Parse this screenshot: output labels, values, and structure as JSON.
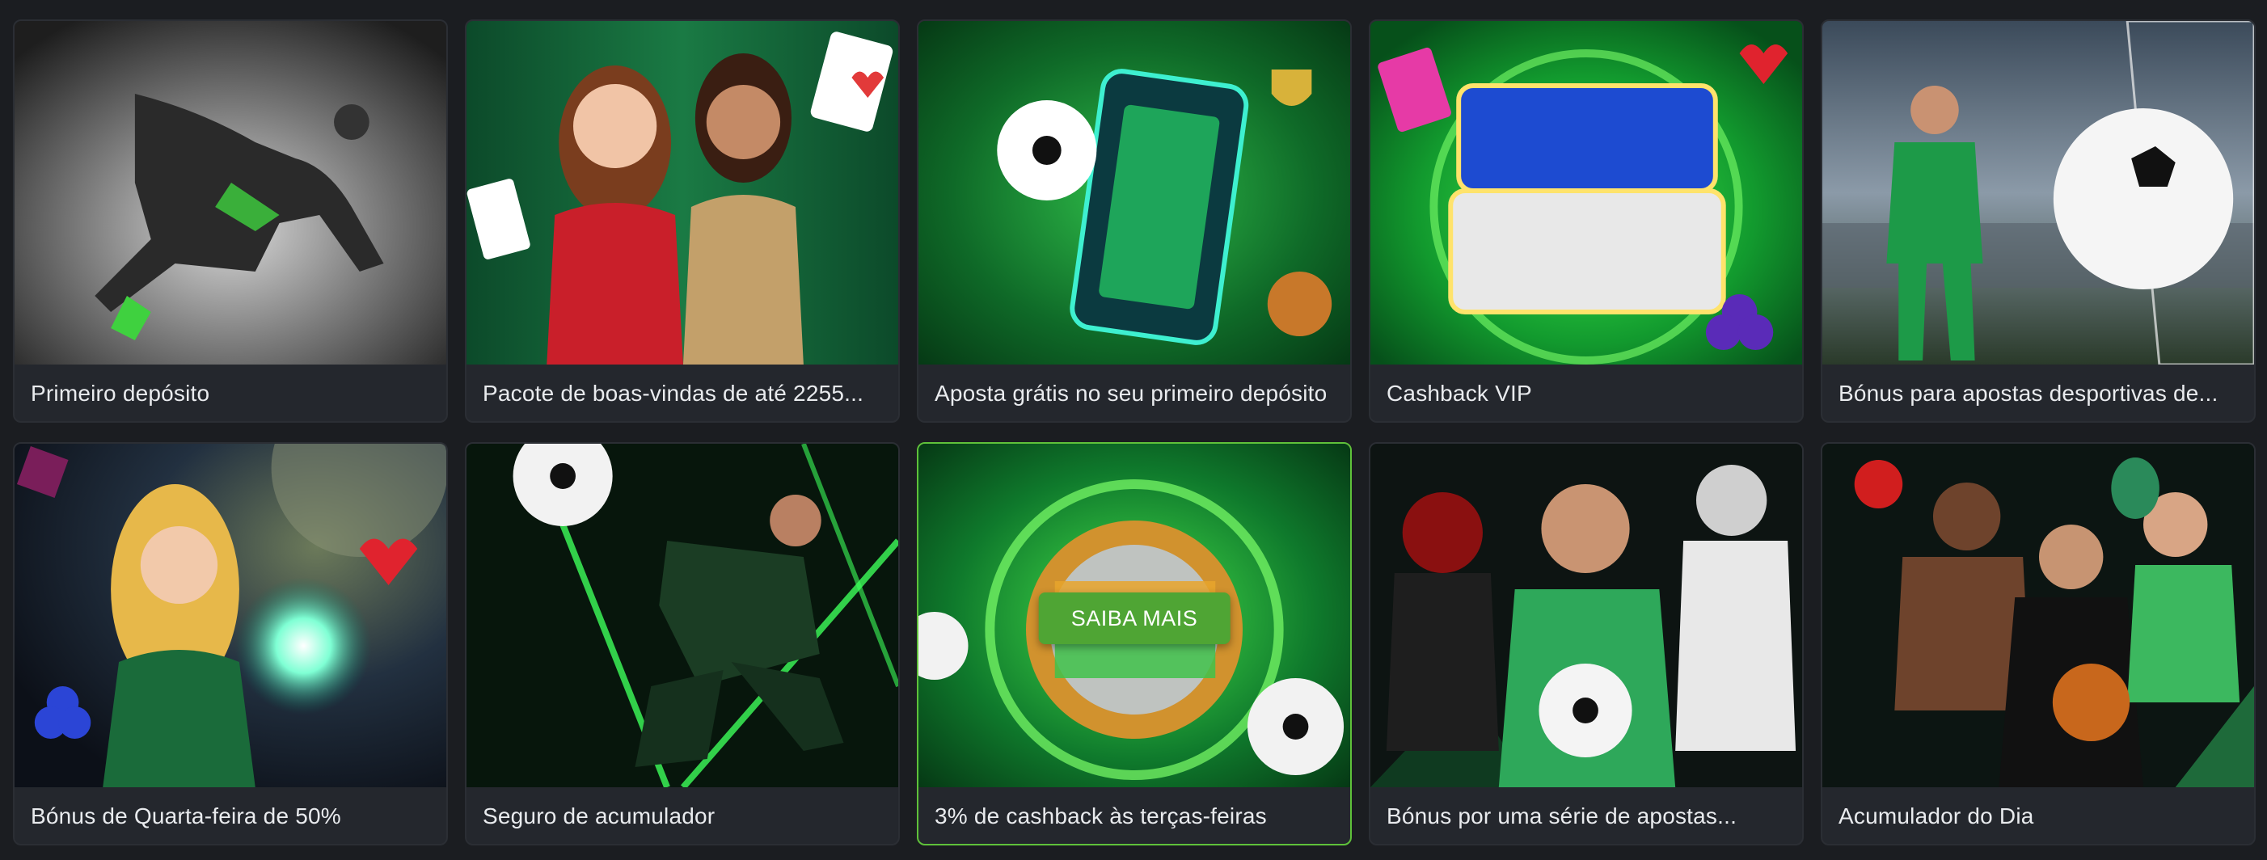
{
  "promotions": [
    {
      "title": "Primeiro depósito",
      "art": "footballer-kick-bw"
    },
    {
      "title": "Pacote de boas-vindas de até 2255...",
      "art": "casino-hostesses-cards"
    },
    {
      "title": "Aposta grátis no seu primeiro depósito",
      "art": "phone-pitch-football"
    },
    {
      "title": "Cashback VIP",
      "art": "cashback-sign-hearts-clubs"
    },
    {
      "title": "Bónus para apostas desportivas de...",
      "art": "goalkeeper-ball-net"
    },
    {
      "title": "Bónus de Quarta-feira de 50%",
      "art": "sorceress-orb-suits"
    },
    {
      "title": "Seguro de acumulador",
      "art": "footballer-neon-frame"
    },
    {
      "title": "3% de cashback às terças-feiras",
      "art": "cashback-coin-balls",
      "hover_button": "SAIBA MAIS"
    },
    {
      "title": "Bónus por uma série de apostas...",
      "art": "multi-sport-athletes"
    },
    {
      "title": "Acumulador do Dia",
      "art": "boxer-tennis-basketball"
    }
  ],
  "colors": {
    "page_bg": "#1b1d21",
    "card_bg": "#24272d",
    "accent_green": "#4fa534",
    "hover_border": "#5fc13a",
    "label_text": "#e9ebee"
  }
}
